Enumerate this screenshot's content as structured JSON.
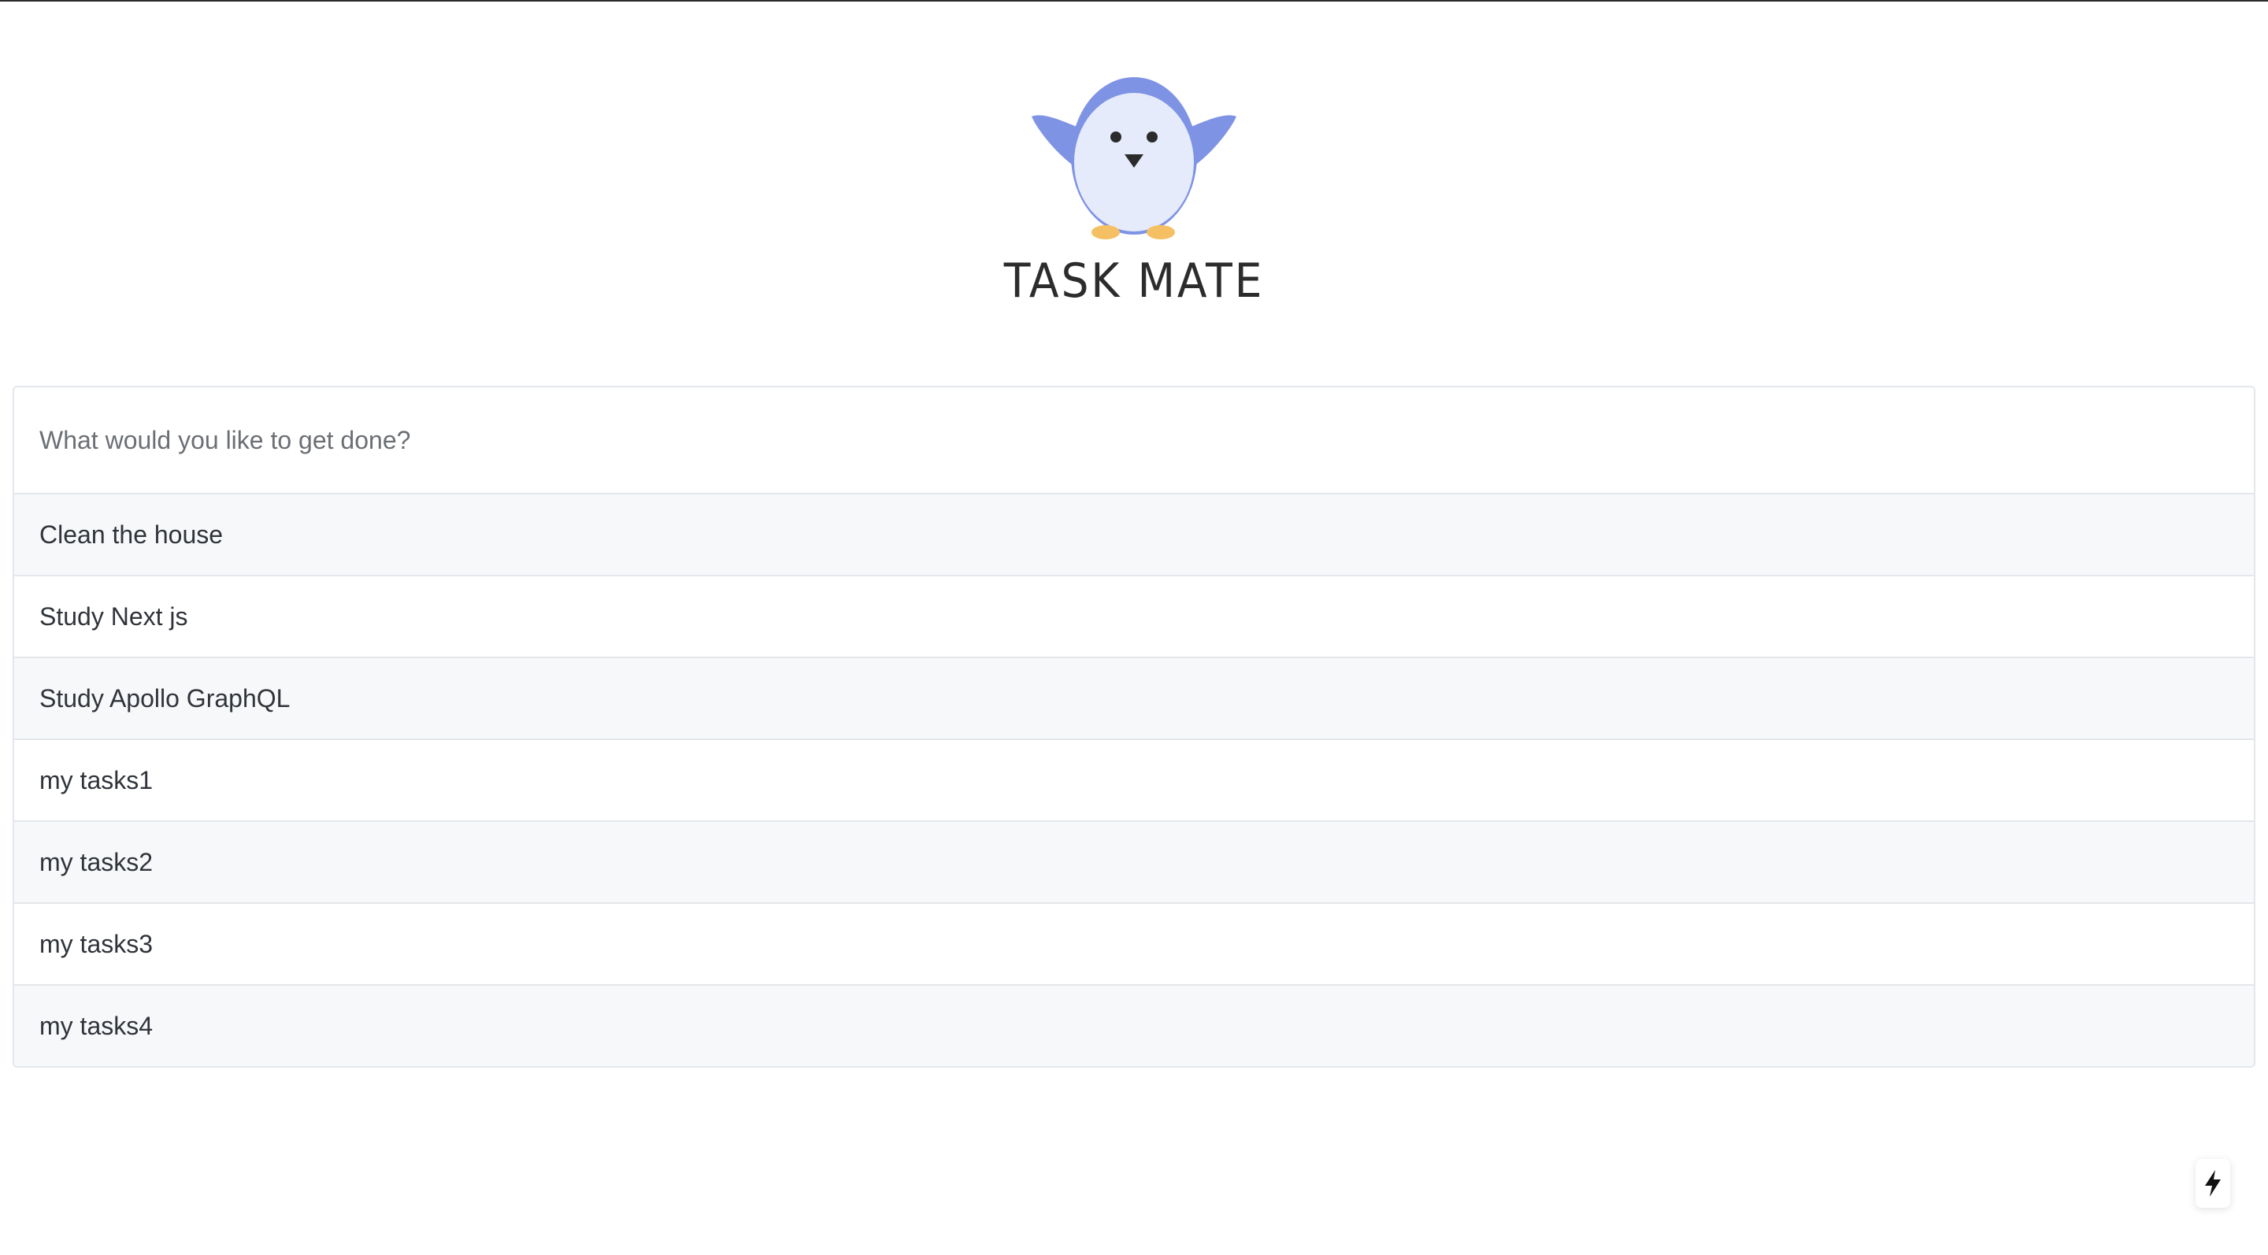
{
  "app": {
    "title": "TASK MATE",
    "mascot_icon": "penguin-icon"
  },
  "input": {
    "placeholder": "What would you like to get done?",
    "value": ""
  },
  "tasks": [
    {
      "label": "Clean the house"
    },
    {
      "label": "Study Next js"
    },
    {
      "label": "Study Apollo GraphQL"
    },
    {
      "label": "my tasks1"
    },
    {
      "label": "my tasks2"
    },
    {
      "label": "my tasks3"
    },
    {
      "label": "my tasks4"
    }
  ],
  "dev_indicator": {
    "icon": "lightning-bolt-icon"
  },
  "colors": {
    "mascot_body": "#7f93e4",
    "mascot_belly": "#e6ebfb",
    "mascot_feet": "#f5c064",
    "row_alt": "#f7f8fa",
    "border": "#e3e6ea",
    "text": "#30343a"
  }
}
